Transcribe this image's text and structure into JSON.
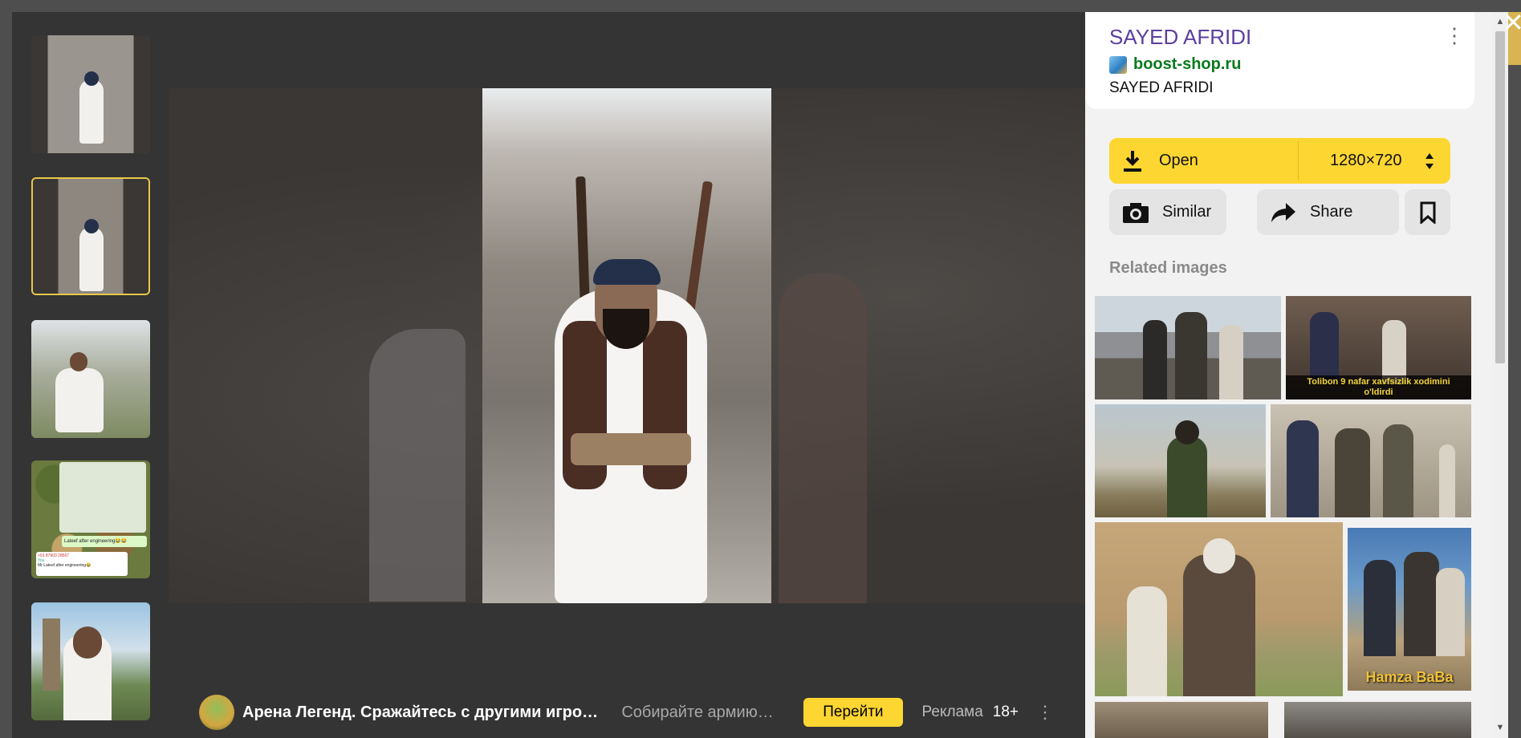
{
  "panel": {
    "title": "SAYED AFRIDI",
    "domain": "boost-shop.ru",
    "subtitle": "SAYED AFRIDI",
    "more_icon": "⋮",
    "open_label": "Open",
    "size_label": "1280×720",
    "similar_label": "Similar",
    "share_label": "Share",
    "related_title": "Related images",
    "related": [
      {
        "caption": ""
      },
      {
        "caption": "Tolibon 9 nafar xavfsizlik xodimini o'ldirdi"
      },
      {
        "caption": ""
      },
      {
        "caption": ""
      },
      {
        "caption": ""
      },
      {
        "caption": "Hamza BaBa"
      },
      {
        "caption": ""
      },
      {
        "caption": ""
      }
    ]
  },
  "thumbnails": [
    {
      "index": 1,
      "active": false
    },
    {
      "index": 2,
      "active": true
    },
    {
      "index": 3,
      "active": false
    },
    {
      "index": 4,
      "active": false,
      "texts": [
        "Lateef after engineering😂😂",
        "+91 87903 28567",
        "You",
        "Mr Lateef after engineering😂"
      ]
    },
    {
      "index": 5,
      "active": false
    }
  ],
  "ad": {
    "title": "Арена Легенд. Сражайтесь с другими игроками",
    "description": "Собирайте армию героев",
    "button": "Перейти",
    "label": "Реклама",
    "age": "18+",
    "more_icon": "⋮"
  },
  "close_icon": "✕",
  "colors": {
    "accent_yellow": "#fdd632",
    "title_purple": "#5b3fa0",
    "domain_green": "#0a7a1d",
    "viewer_bg": "#343434"
  }
}
